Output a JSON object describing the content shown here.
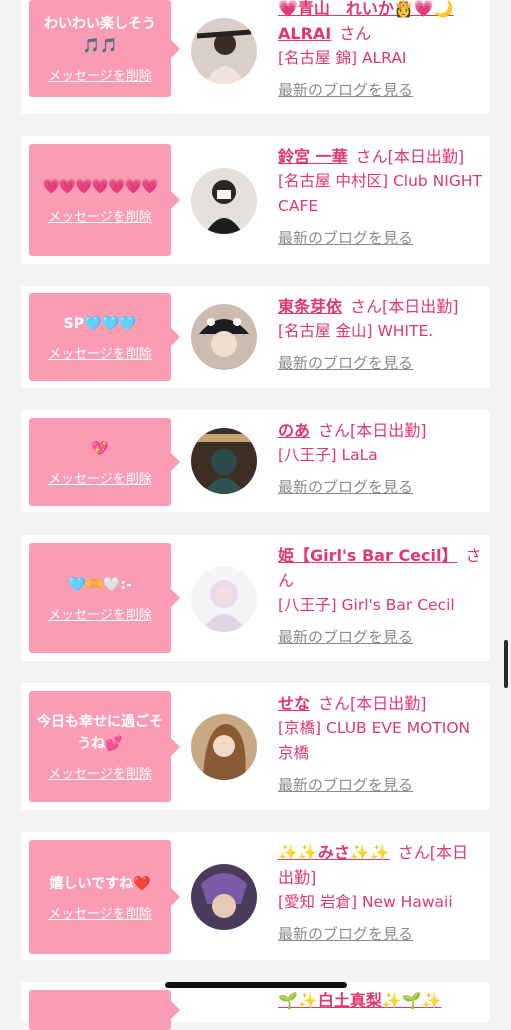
{
  "delete_label": "メッセージを削除",
  "blog_label": "最新のブログを見る",
  "san_label": "さん",
  "cards": [
    {
      "message": "わいわい楽しそう🎵🎵",
      "name": "💗青山　れいか👸💗🌙ALRAI",
      "status": "",
      "shop": "[名古屋 錦] ALRAI"
    },
    {
      "message": "💗💗💗💗💗💗💗",
      "name": "鈴宮 一華",
      "status": "[本日出勤]",
      "shop": "[名古屋 中村区] Club NIGHT CAFE"
    },
    {
      "message": "SP🩵🩵🩵",
      "name": "東条芽依",
      "status": "[本日出勤]",
      "shop": "[名古屋 金山] WHITE."
    },
    {
      "message": "💖",
      "name": "のあ",
      "status": "[本日出勤]",
      "shop": "[八王子] LaLa"
    },
    {
      "message": "🩵🫶🤍:-",
      "name": "姫【Girl's Bar Cecil】",
      "status": "",
      "shop": "[八王子] Girl's Bar Cecil"
    },
    {
      "message": "今日も幸せに過ごそうね💕",
      "name": "せな",
      "status": "[本日出勤]",
      "shop": "[京橋] CLUB EVE MOTION 京橋"
    },
    {
      "message": "嬉しいですね❤️",
      "name": "✨✨みさ✨✨",
      "status": "[本日出勤]",
      "shop": "[愛知 岩倉] New Hawaii"
    },
    {
      "message": "",
      "name": "🌱✨白土真梨✨🌱✨",
      "status": "",
      "shop": ""
    }
  ]
}
